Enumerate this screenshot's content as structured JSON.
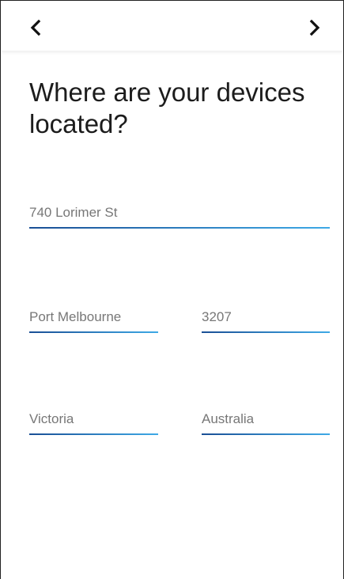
{
  "nav": {
    "back_icon": "chevron-left-icon",
    "next_icon": "chevron-right-icon"
  },
  "title": "Where are your devices located?",
  "fields": {
    "street": {
      "value": "740 Lorimer St"
    },
    "city": {
      "value": "Port Melbourne"
    },
    "postcode": {
      "value": "3207"
    },
    "state": {
      "value": "Victoria"
    },
    "country": {
      "value": "Australia"
    }
  },
  "colors": {
    "underline_start": "#1a4f95",
    "underline_end": "#3ea9e6",
    "input_text": "#777777",
    "title_text": "#1c1c1c"
  }
}
